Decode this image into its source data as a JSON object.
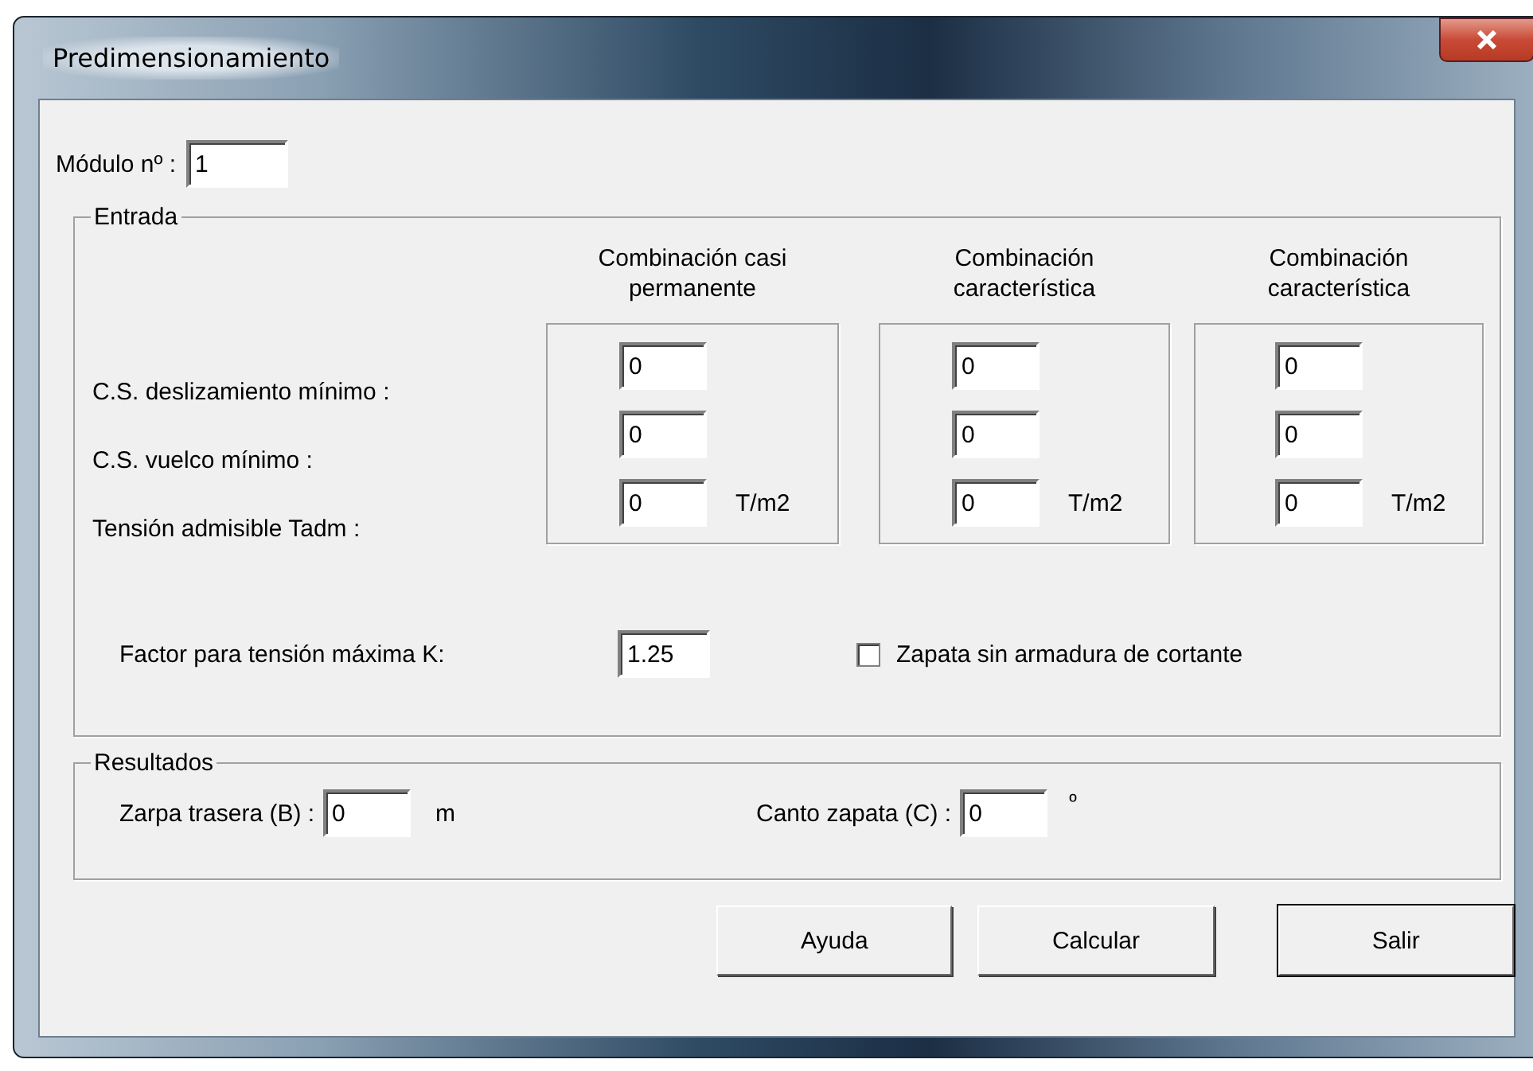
{
  "window": {
    "title": "Predimensionamiento"
  },
  "module": {
    "label": "Módulo nº :",
    "value": "1"
  },
  "entrada": {
    "legend": "Entrada",
    "rows": [
      {
        "label": "C.S. deslizamiento mínimo :"
      },
      {
        "label": "C.S. vuelco mínimo :"
      },
      {
        "label": "Tensión admisible  Tadm :"
      }
    ],
    "columns": [
      {
        "heading": "Combinación casi permanente",
        "fields": [
          {
            "value": "0"
          },
          {
            "value": "0"
          },
          {
            "value": "0",
            "unit": "T/m2"
          }
        ]
      },
      {
        "heading": "Combinación característica",
        "fields": [
          {
            "value": "0"
          },
          {
            "value": "0"
          },
          {
            "value": "0",
            "unit": "T/m2"
          }
        ]
      },
      {
        "heading": "Combinación característica",
        "fields": [
          {
            "value": "0"
          },
          {
            "value": "0"
          },
          {
            "value": "0",
            "unit": "T/m2"
          }
        ]
      }
    ],
    "factor": {
      "label": "Factor para tensión máxima K:",
      "value": "1.25"
    },
    "checkbox": {
      "label": "Zapata sin armadura de cortante",
      "checked": false
    }
  },
  "resultados": {
    "legend": "Resultados",
    "fields": [
      {
        "label": "Zarpa trasera (B) :",
        "value": "0",
        "unit": "m"
      },
      {
        "label": "Canto zapata (C) :",
        "value": "0",
        "unit": "º"
      }
    ]
  },
  "buttons": [
    {
      "label": "Ayuda",
      "default": false
    },
    {
      "label": "Calcular",
      "default": false
    },
    {
      "label": "Salir",
      "default": true
    }
  ]
}
